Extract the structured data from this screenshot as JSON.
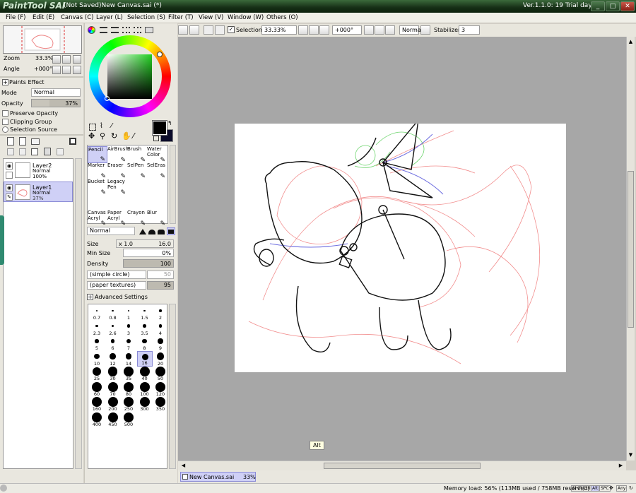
{
  "window": {
    "app_logo": "PaintTool SAI",
    "title": "(Not Saved)New Canvas.sai (*)",
    "version": "Ver.1.1.0: 19 Trial day"
  },
  "menu": [
    "File (F)",
    "Edit (E)",
    "Canvas (C)",
    "Layer (L)",
    "Selection (S)",
    "Filter (T)",
    "View (V)",
    "Window (W)",
    "Others (O)"
  ],
  "toolbar": {
    "selection_label": "Selection",
    "zoom": "33.33%",
    "angle": "+000°",
    "blend": "Normal",
    "stabilizer_label": "Stabilizer",
    "stabilizer": "3"
  },
  "navigator": {
    "zoom_label": "Zoom",
    "zoom_value": "33.3%",
    "angle_label": "Angle",
    "angle_value": "+000°"
  },
  "layer_panel": {
    "paints_effect": "Paints Effect",
    "mode_label": "Mode",
    "mode": "Normal",
    "opacity_label": "Opacity",
    "opacity": "37%",
    "opacity_fraction": 0.37,
    "preserve_opacity": "Preserve Opacity",
    "clipping_group": "Clipping Group",
    "selection_source": "Selection Source",
    "layers": [
      {
        "name": "Layer2",
        "mode": "Normal",
        "opacity": "100%"
      },
      {
        "name": "Layer1",
        "mode": "Normal",
        "opacity": "37%"
      }
    ]
  },
  "tools": [
    {
      "label": "Pencil"
    },
    {
      "label": "AirBrush"
    },
    {
      "label": "Brush"
    },
    {
      "label": "Water Color"
    },
    {
      "label": "Marker"
    },
    {
      "label": "Eraser"
    },
    {
      "label": "SelPen"
    },
    {
      "label": "SelEras"
    },
    {
      "label": "Bucket"
    },
    {
      "label": "Legacy Pen"
    },
    {
      "label": "Canvas Acryl"
    },
    {
      "label": "Paper Acryl"
    },
    {
      "label": "Crayon"
    },
    {
      "label": "Blur"
    }
  ],
  "brush_settings": {
    "blend": "Normal",
    "size_label": "Size",
    "size_mult": "x 1.0",
    "size": "16.0",
    "min_size_label": "Min Size",
    "min_size": "0%",
    "density_label": "Density",
    "density": "100",
    "shape": "(simple circle)",
    "shape_value": "50",
    "texture": "(paper textures)",
    "texture_value": "95",
    "advanced": "Advanced Settings"
  },
  "brush_sizes": [
    "0.7",
    "0.8",
    "1",
    "1.5",
    "2",
    "2.3",
    "2.6",
    "3",
    "3.5",
    "4",
    "5",
    "6",
    "7",
    "8",
    "9",
    "10",
    "12",
    "14",
    "16",
    "20",
    "25",
    "30",
    "35",
    "40",
    "50",
    "60",
    "70",
    "80",
    "100",
    "120",
    "160",
    "200",
    "250",
    "300",
    "350",
    "400",
    "450",
    "500"
  ],
  "tooltip": "Alt",
  "canvas_tab": {
    "name": "New Canvas.sai",
    "zoom": "33%"
  },
  "status": {
    "memory": "Memory load: 56% (113MB used / 758MB reserved)",
    "keys": [
      "Shift",
      "Ctrl",
      "Alt",
      "SPC",
      "Any"
    ]
  },
  "colors": {
    "accent": "#cfd0f6",
    "title_bar": "#1f3d1f",
    "canvas_bg": "#a7a7a7",
    "foreground": "#000000",
    "background_swatch": "#0b0b2a"
  }
}
